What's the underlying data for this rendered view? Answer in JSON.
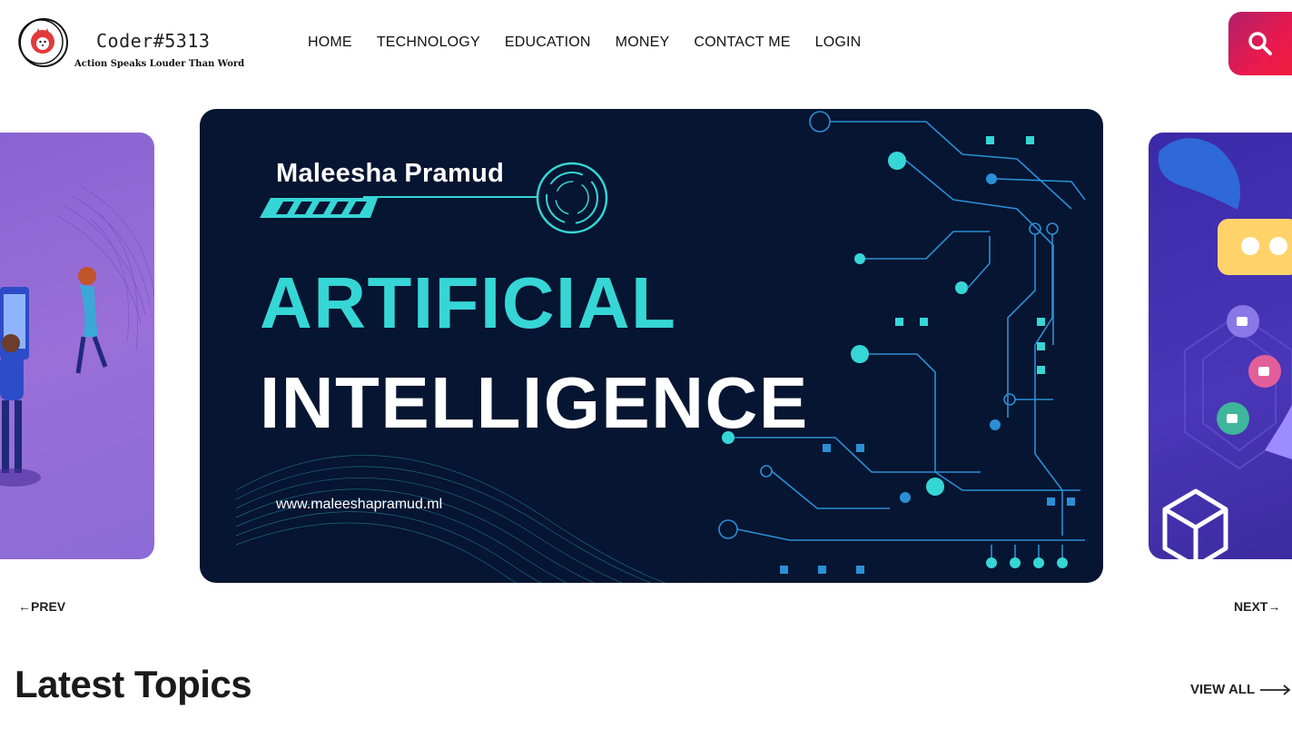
{
  "brand": {
    "name": "Coder#5313",
    "tagline": "Action Speaks Louder Than Word",
    "logo_icon": "fox-face-icon"
  },
  "nav": {
    "items": [
      {
        "label": "HOME"
      },
      {
        "label": "TECHNOLOGY"
      },
      {
        "label": "EDUCATION"
      },
      {
        "label": "MONEY"
      },
      {
        "label": "CONTACT ME"
      },
      {
        "label": "LOGIN"
      }
    ]
  },
  "search": {
    "icon": "search-icon",
    "accent_from": "#b0206a",
    "accent_to": "#f01d3c"
  },
  "carousel": {
    "active_slide": {
      "author": "Maleesha Pramud",
      "title_line1": "ARTIFICIAL",
      "title_line2": "INTELLIGENCE",
      "url": "www.maleeshapramud.ml",
      "bg_color": "#061531",
      "accent_color": "#36d6d6"
    },
    "prev_label": "PREV",
    "next_label": "NEXT"
  },
  "latest": {
    "title": "Latest Topics",
    "view_all_label": "VIEW ALL"
  }
}
